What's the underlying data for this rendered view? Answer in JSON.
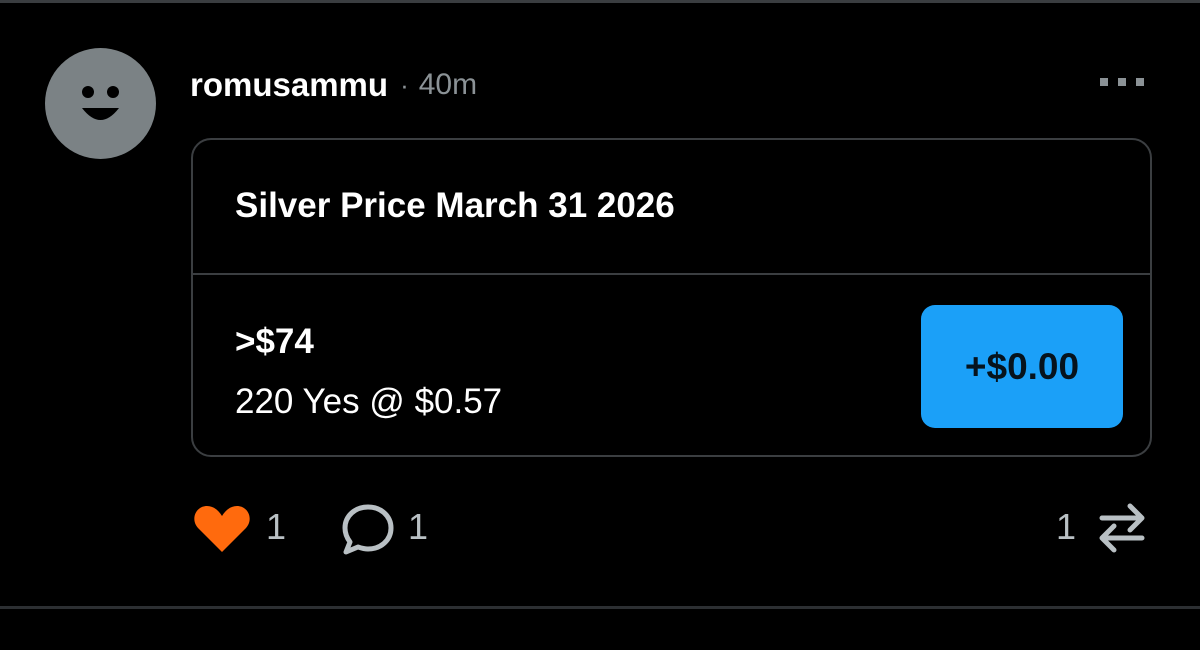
{
  "post": {
    "username": "romusammu",
    "separator": "·",
    "time_ago": "40m",
    "avatar_icon": "smiley-avatar-icon",
    "more_icon": "more-dots-icon"
  },
  "market_card": {
    "title": "Silver Price March 31 2026",
    "outcome": ">$74",
    "position": "220 Yes @ $0.57",
    "pnl_label": "+$0.00",
    "pnl_button_color": "#1ba0f8"
  },
  "actions": {
    "like_count": "1",
    "comment_count": "1",
    "repost_count": "1",
    "like_icon": "heart-icon",
    "comment_icon": "comment-bubble-icon",
    "repost_icon": "repost-arrows-icon",
    "like_color": "#ff6a0d"
  }
}
